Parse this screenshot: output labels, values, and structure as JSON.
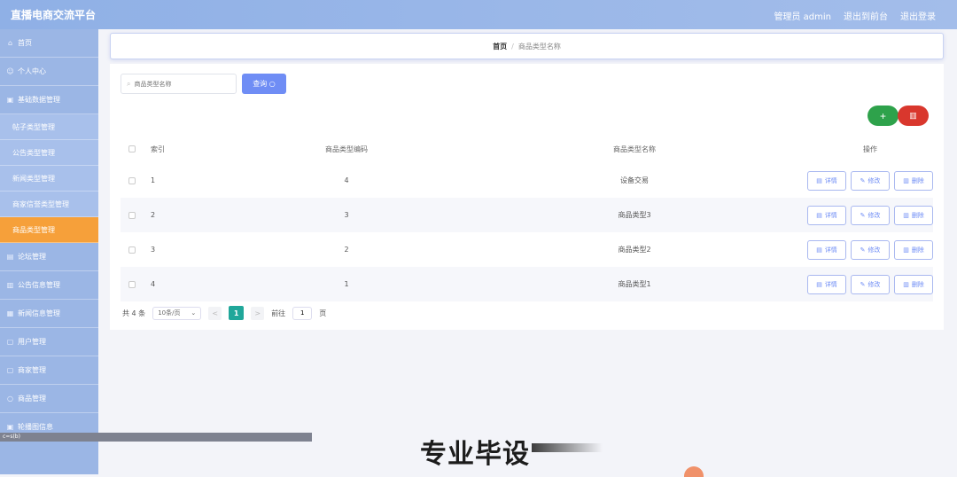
{
  "app": {
    "title": "直播电商交流平台"
  },
  "topbar": {
    "links": [
      "管理员 admin",
      "退出到前台",
      "退出登录"
    ]
  },
  "sidebar": {
    "items": [
      {
        "label": "首页",
        "icon": "home-icon",
        "type": "top"
      },
      {
        "label": "个人中心",
        "icon": "user-icon",
        "type": "top"
      },
      {
        "label": "基础数据管理",
        "icon": "database-icon",
        "type": "top"
      },
      {
        "label": "帖子类型管理",
        "type": "sub"
      },
      {
        "label": "公告类型管理",
        "type": "sub"
      },
      {
        "label": "新闻类型管理",
        "type": "sub"
      },
      {
        "label": "商家信誉类型管理",
        "type": "sub"
      },
      {
        "label": "商品类型管理",
        "type": "sub",
        "active": true
      },
      {
        "label": "论坛管理",
        "icon": "forum-icon",
        "type": "top"
      },
      {
        "label": "公告信息管理",
        "icon": "notice-icon",
        "type": "top"
      },
      {
        "label": "新闻信息管理",
        "icon": "news-icon",
        "type": "top"
      },
      {
        "label": "用户管理",
        "icon": "users-icon",
        "type": "top"
      },
      {
        "label": "商家管理",
        "icon": "shop-icon",
        "type": "top"
      },
      {
        "label": "商品管理",
        "icon": "goods-icon",
        "type": "top"
      },
      {
        "label": "轮播图信息",
        "icon": "image-icon",
        "type": "top"
      }
    ],
    "bottom_text": "c=s(b)"
  },
  "breadcrumb": {
    "home": "首页",
    "separator": "/",
    "current": "商品类型名称"
  },
  "search": {
    "placeholder": "商品类型名称",
    "button_label": "查询",
    "button_icon": "search-icon"
  },
  "actions": {
    "add_icon": "+",
    "delete_icon": "trash-icon"
  },
  "table": {
    "headers": {
      "index": "索引",
      "code": "商品类型编码",
      "name": "商品类型名称",
      "ops": "操作"
    },
    "op_labels": {
      "detail": "详情",
      "edit": "修改",
      "delete": "删除"
    },
    "rows": [
      {
        "index": "1",
        "code": "4",
        "name": "设备交易"
      },
      {
        "index": "2",
        "code": "3",
        "name": "商品类型3"
      },
      {
        "index": "3",
        "code": "2",
        "name": "商品类型2"
      },
      {
        "index": "4",
        "code": "1",
        "name": "商品类型1"
      }
    ]
  },
  "pager": {
    "total": "共 4 条",
    "page_size": "10条/页",
    "prev": "<",
    "current_page": "1",
    "next": ">",
    "goto_label": "前往",
    "goto_value": "1",
    "page_suffix": "页"
  },
  "overlay": {
    "watermark": "专业毕设"
  },
  "colors": {
    "accent": "#6f8df5",
    "active_menu": "#f6a03a",
    "add": "#2ea24b",
    "delete": "#d9372d",
    "page_active": "#20a79a"
  }
}
